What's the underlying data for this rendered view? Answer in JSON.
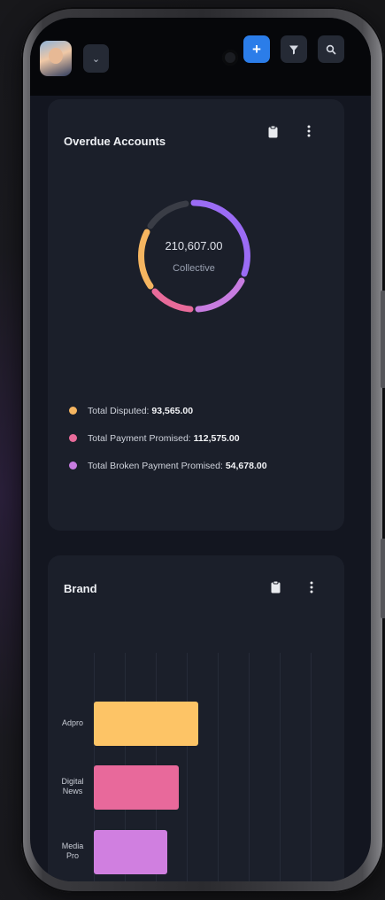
{
  "topbar": {
    "dropdown_icon": "chevron-down-icon",
    "add_icon": "plus-icon",
    "add_label": "+",
    "filter_icon": "filter-icon",
    "search_icon": "search-icon"
  },
  "overdue": {
    "title": "Overdue Accounts",
    "total_value": "210,607.00",
    "total_label": "Collective",
    "legend": [
      {
        "label": "Total Disputed:",
        "value": "93,565.00",
        "color": "#f5b560"
      },
      {
        "label": "Total Payment Promised:",
        "value": "112,575.00",
        "color": "#e86b9a"
      },
      {
        "label": "Total Broken Payment Promised:",
        "value": "54,678.00",
        "color": "#c77ce0"
      }
    ]
  },
  "brand": {
    "title": "Brand"
  },
  "chart_data": {
    "type": "bar",
    "orientation": "horizontal",
    "categories": [
      "Adpro",
      "Digital News",
      "Media Pro"
    ],
    "values": [
      120,
      98,
      85
    ],
    "colors": [
      "#fdc466",
      "#e8699b",
      "#d07fe0"
    ],
    "title": "Brand",
    "xlabel": "",
    "ylabel": "",
    "xlim": [
      0,
      250
    ],
    "grid": true
  },
  "colors": {
    "accent": "#2b7de9",
    "donut_segments": [
      "#9b6cf5",
      "#c77ce0",
      "#e86b9a",
      "#f5b560",
      "#3a3d46"
    ]
  }
}
